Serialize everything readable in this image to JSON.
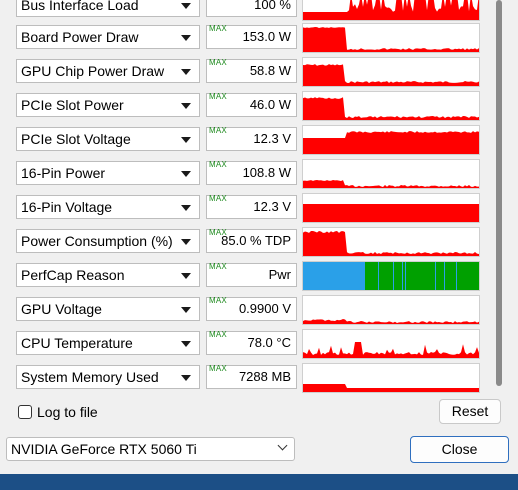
{
  "sensors": [
    {
      "name": "Bus Interface Load",
      "max_label": "",
      "value": "100 %",
      "graph": "bus"
    },
    {
      "name": "Board Power Draw",
      "max_label": "MAX",
      "value": "153.0 W",
      "graph": "board"
    },
    {
      "name": "GPU Chip Power Draw",
      "max_label": "MAX",
      "value": "58.8 W",
      "graph": "chip"
    },
    {
      "name": "PCIe Slot Power",
      "max_label": "MAX",
      "value": "46.0 W",
      "graph": "slotpower"
    },
    {
      "name": "PCIe Slot Voltage",
      "max_label": "MAX",
      "value": "12.3 V",
      "graph": "slotvolt"
    },
    {
      "name": "16-Pin Power",
      "max_label": "MAX",
      "value": "108.8 W",
      "graph": "pinpower"
    },
    {
      "name": "16-Pin Voltage",
      "max_label": "MAX",
      "value": "12.3 V",
      "graph": "pinvolt"
    },
    {
      "name": "Power Consumption (%)",
      "max_label": "MAX",
      "value": "85.0 % TDP",
      "graph": "consumption"
    },
    {
      "name": "PerfCap Reason",
      "max_label": "MAX",
      "value": "Pwr",
      "graph": "perfcap"
    },
    {
      "name": "GPU Voltage",
      "max_label": "MAX",
      "value": "0.9900 V",
      "graph": "gpuvolt"
    },
    {
      "name": "CPU Temperature",
      "max_label": "MAX",
      "value": "78.0 °C",
      "graph": "cputemp"
    },
    {
      "name": "System Memory Used",
      "max_label": "MAX",
      "value": "7288 MB",
      "graph": "sysmem"
    }
  ],
  "log_to_file_label": "Log to file",
  "log_to_file_checked": false,
  "reset_label": "Reset",
  "gpu_select_value": "NVIDIA GeForce RTX 5060 Ti",
  "close_label": "Close",
  "colors": {
    "graph_red": "#ff0000",
    "perfcap_blue": "#2aa0e8",
    "perfcap_green": "#00a000",
    "max_green": "#1e8a1e",
    "taskbar": "#1c4f86"
  }
}
